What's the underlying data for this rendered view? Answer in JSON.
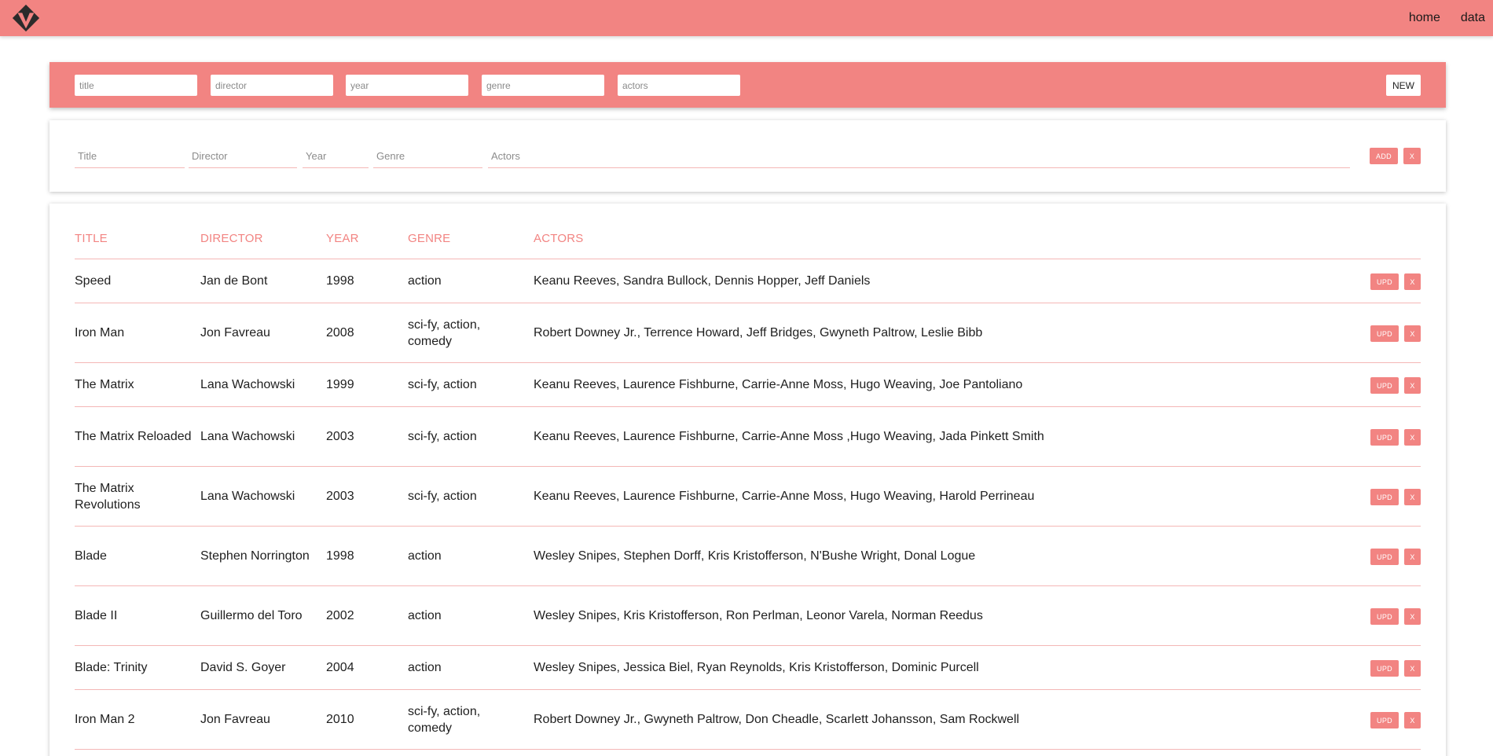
{
  "nav": {
    "links": [
      "home",
      "data"
    ]
  },
  "filter": {
    "placeholders": [
      "title",
      "director",
      "year",
      "genre",
      "actors"
    ],
    "new_label": "NEW"
  },
  "add_form": {
    "placeholders": [
      "Title",
      "Director",
      "Year",
      "Genre",
      "Actors"
    ],
    "add_label": "ADD",
    "close_label": "X"
  },
  "table": {
    "headers": [
      "TITLE",
      "DIRECTOR",
      "YEAR",
      "GENRE",
      "ACTORS"
    ],
    "update_label": "UPD",
    "delete_label": "X",
    "rows": [
      {
        "title": "Speed",
        "director": "Jan de Bont",
        "year": "1998",
        "genre": "action",
        "actors": "Keanu Reeves, Sandra Bullock, Dennis Hopper, Jeff Daniels"
      },
      {
        "title": "Iron Man",
        "director": "Jon Favreau",
        "year": "2008",
        "genre": "sci-fy, action, comedy",
        "actors": "Robert Downey Jr., Terrence Howard, Jeff Bridges, Gwyneth Paltrow, Leslie Bibb"
      },
      {
        "title": "The Matrix",
        "director": "Lana Wachowski",
        "year": "1999",
        "genre": "sci-fy, action",
        "actors": "Keanu Reeves, Laurence Fishburne, Carrie-Anne Moss, Hugo Weaving, Joe Pantoliano"
      },
      {
        "title": "The Matrix Reloaded",
        "director": "Lana Wachowski",
        "year": "2003",
        "genre": "sci-fy, action",
        "actors": "Keanu Reeves, Laurence Fishburne, Carrie-Anne Moss ,Hugo Weaving, Jada Pinkett Smith"
      },
      {
        "title": "The Matrix Revolutions",
        "director": "Lana Wachowski",
        "year": "2003",
        "genre": "sci-fy, action",
        "actors": "Keanu Reeves, Laurence Fishburne, Carrie-Anne Moss, Hugo Weaving, Harold Perrineau"
      },
      {
        "title": "Blade",
        "director": "Stephen Norrington",
        "year": "1998",
        "genre": "action",
        "actors": "Wesley Snipes, Stephen Dorff, Kris Kristofferson, N'Bushe Wright, Donal Logue"
      },
      {
        "title": "Blade II",
        "director": "Guillermo del Toro",
        "year": "2002",
        "genre": "action",
        "actors": "Wesley Snipes, Kris Kristofferson, Ron Perlman, Leonor Varela, Norman Reedus"
      },
      {
        "title": "Blade: Trinity",
        "director": "David S. Goyer",
        "year": "2004",
        "genre": "action",
        "actors": "Wesley Snipes, Jessica Biel, Ryan Reynolds, Kris Kristofferson, Dominic Purcell"
      },
      {
        "title": "Iron Man 2",
        "director": "Jon Favreau",
        "year": "2010",
        "genre": "sci-fy, action, comedy",
        "actors": "Robert Downey Jr., Gwyneth Paltrow, Don Cheadle, Scarlett Johansson, Sam Rockwell"
      }
    ]
  },
  "colors": {
    "accent": "#f28482",
    "divider": "#f4b7b6"
  },
  "icons": {
    "logo": "brand-logo-icon"
  }
}
